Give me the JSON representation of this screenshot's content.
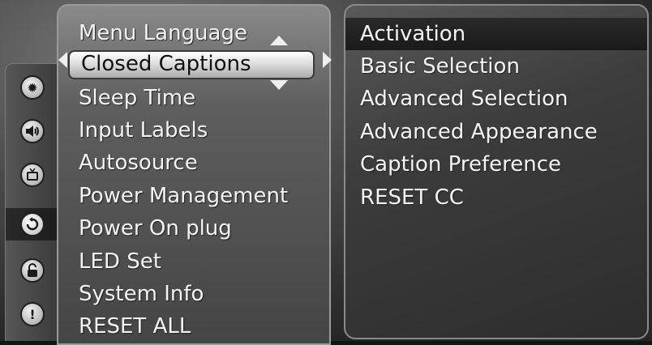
{
  "left_nav": {
    "icons": [
      {
        "name": "settings-sun-icon",
        "glyph": "✹"
      },
      {
        "name": "audio-speaker-icon",
        "glyph": "🔊"
      },
      {
        "name": "tv-icon",
        "glyph": "📺"
      },
      {
        "name": "setup-cycle-icon",
        "glyph": "↻",
        "active": true
      },
      {
        "name": "lock-icon",
        "glyph": "🔓"
      },
      {
        "name": "alert-icon",
        "glyph": "!"
      }
    ]
  },
  "menu": {
    "items": [
      "Menu Language",
      "Closed Captions",
      "Sleep Time",
      "Input Labels",
      "Autosource",
      "Power Management",
      "Power On plug",
      "LED Set",
      "System Info",
      "RESET ALL"
    ],
    "selected_index": 1
  },
  "submenu": {
    "items": [
      "Activation",
      "Basic Selection",
      "Advanced Selection",
      "Advanced Appearance",
      "Caption Preference",
      "RESET CC"
    ],
    "highlighted_index": 0
  }
}
